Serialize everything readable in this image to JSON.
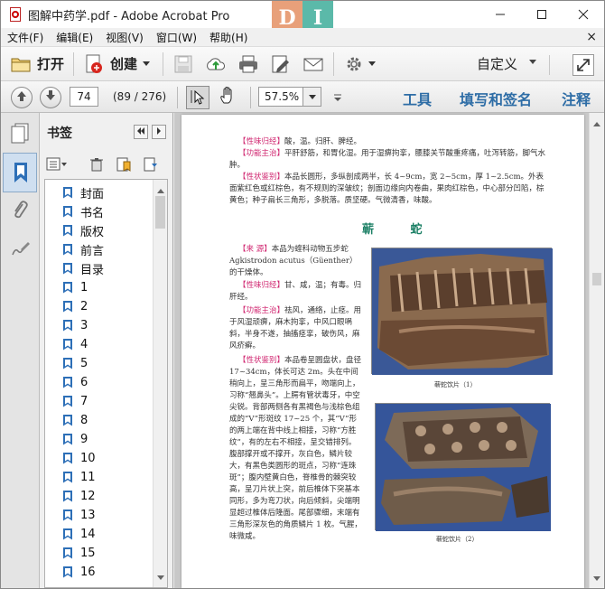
{
  "window": {
    "title": "图解中药学.pdf - Adobe Acrobat Pro",
    "logo_letters": [
      "D",
      "I"
    ],
    "buttons": [
      "minimize",
      "maximize",
      "close"
    ]
  },
  "menu": {
    "items": [
      "文件(F)",
      "编辑(E)",
      "视图(V)",
      "窗口(W)",
      "帮助(H)"
    ],
    "close_glyph": "×"
  },
  "toolbar1": {
    "open_label": "打开",
    "create_label": "创建",
    "custom_label": "自定义"
  },
  "toolbar2": {
    "page_input": "74",
    "page_count": "(89 / 276)",
    "zoom_value": "57.5%",
    "links": [
      "工具",
      "填写和签名",
      "注释"
    ]
  },
  "bookmarks": {
    "title": "书签",
    "items": [
      "封面",
      "书名",
      "版权",
      "前言",
      "目录",
      "1",
      "2",
      "3",
      "4",
      "5",
      "6",
      "7",
      "8",
      "9",
      "10",
      "11",
      "12",
      "13",
      "14",
      "15",
      "16"
    ]
  },
  "document": {
    "top_lines": [
      {
        "tag": "【性味归经】",
        "text": "酸，温。归肝、脾经。"
      },
      {
        "tag": "【功能主治】",
        "text": "平肝舒筋，和胃化湿。用于湿痹拘挛，腰膝关节酸重疼痛，吐泻转筋，脚气水肿。"
      },
      {
        "tag": "【性状鉴别】",
        "text": "本品长圆形，多纵剖成两半，长 4~9cm，宽 2~5cm，厚 1~2.5cm。外表面紫红色或红棕色，有不规则的深皱纹；剖面边缘向内卷曲，果肉红棕色，中心部分凹陷，棕黄色；种子扁长三角形，多脱落。质坚硬。气微清香，味酸。"
      }
    ],
    "herb_title": "蕲 蛇",
    "sections": [
      {
        "tag": "【来    源】",
        "text": "本品为蝰科动物五步蛇 Agkistrodon acutus（Güenther）的干燥体。"
      },
      {
        "tag": "【性味归经】",
        "text": "甘、咸，温；有毒。归肝经。"
      },
      {
        "tag": "【功能主治】",
        "text": "祛风，通络，止痉。用于风湿顽痹，麻木拘挛，中风口眼㖞斜，半身不遂，抽搐痉挛，破伤风，麻风疥癣。"
      },
      {
        "tag": "【性状鉴别】",
        "text": "本品卷呈圆盘状，盘径 17~34cm，体长可达 2m。头在中间稍向上，呈三角形而扁平，吻端向上，习称“翘鼻头”。上腭有管状毒牙，中空尖锐。背部两侧各有黑褐色与浅棕色组成的“V”形斑纹 17~25 个，其“V”形的两上端在背中线上相接，习称“方胜纹”，有的左右不相接，呈交错排列。腹部撑开或不撑开，灰白色，鳞片较大，有黑色类圆形的斑点，习称“连珠斑”；腹内壁黄白色，脊椎骨的棘突较高，呈刀片状上突，前后椎体下突基本同形，多为弯刀状，向后倾斜，尖端明显超过椎体后隆面。尾部骤细，末端有三角形深灰色的角质鳞片 1 枚。气腥，味微咸。"
      }
    ],
    "captions": [
      "蕲蛇饮片（1）",
      "蕲蛇饮片（2）"
    ]
  },
  "colors": {
    "tag": "#d02670",
    "herb_title": "#1a7f64",
    "link": "#2e6da6"
  }
}
